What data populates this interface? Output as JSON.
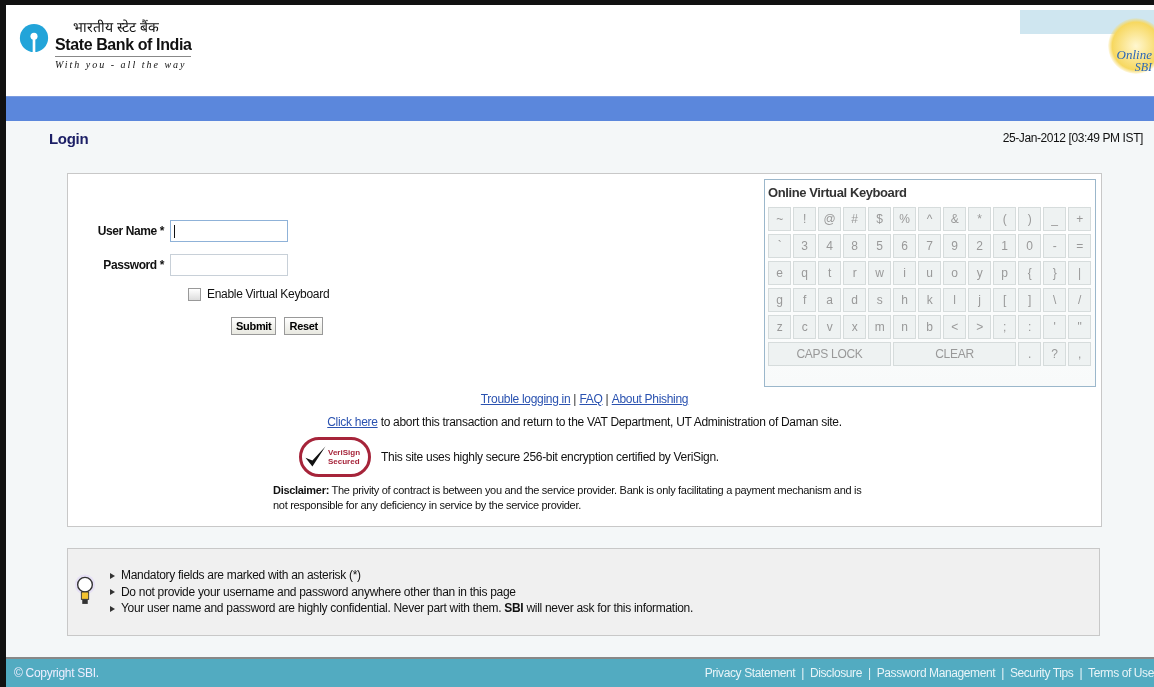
{
  "header": {
    "bank_name_hindi": "भारतीय स्टेट बैंक",
    "bank_name": "State Bank of India",
    "tagline": "With you - all the way",
    "online_logo": [
      "Online",
      "SBI"
    ]
  },
  "page_title": "Login",
  "datetime": "25-Jan-2012 [03:49 PM IST]",
  "form": {
    "fields": [
      {
        "label": "User Name *",
        "focused": true
      },
      {
        "label": "Password *",
        "focused": false
      }
    ],
    "virtual_keyboard_toggle": {
      "label": "Enable Virtual Keyboard",
      "checked": false
    },
    "buttons": [
      "Submit",
      "Reset"
    ]
  },
  "keyboard": {
    "title": "Online Virtual Keyboard",
    "rows": [
      [
        "~",
        "!",
        "@",
        "#",
        "$",
        "%",
        "^",
        "&",
        "*",
        "(",
        ")",
        "_",
        "+"
      ],
      [
        "`",
        "3",
        "4",
        "8",
        "5",
        "6",
        "7",
        "9",
        "2",
        "1",
        "0",
        "-",
        "="
      ],
      [
        "e",
        "q",
        "t",
        "r",
        "w",
        "i",
        "u",
        "o",
        "y",
        "p",
        "{",
        "}",
        "|"
      ],
      [
        "g",
        "f",
        "a",
        "d",
        "s",
        "h",
        "k",
        "l",
        "j",
        "[",
        "]",
        "\\",
        "/"
      ],
      [
        "z",
        "c",
        "v",
        "x",
        "m",
        "n",
        "b",
        "<",
        ">",
        ";",
        ":",
        "'",
        "\""
      ]
    ],
    "bottom_keys": [
      {
        "label": "CAPS LOCK",
        "kind": "wide"
      },
      {
        "label": "CLEAR",
        "kind": "wide"
      },
      {
        "label": ".",
        "kind": "key"
      },
      {
        "label": "?",
        "kind": "key"
      },
      {
        "label": ",",
        "kind": "key"
      }
    ]
  },
  "help_links": {
    "separator": "|",
    "links": [
      "Trouble logging in",
      "FAQ",
      "About Phishing"
    ]
  },
  "abort_notice": {
    "link": "Click here",
    "text": "to abort this transaction and return to the VAT Department, UT Administration of Daman site."
  },
  "verisign": {
    "badge": [
      "VeriSign",
      "Secured"
    ],
    "text": "This site uses highly secure 256-bit encryption certified by VeriSign."
  },
  "disclaimer": "**Disclaimer:** The privity of contract is between you and the service provider. Bank is only facilitating a payment mechanism and is not responsible for any deficiency in service by the service provider.",
  "tips": [
    "Mandatory fields are marked with an asterisk (*)",
    "Do not provide your username and password anywhere other than in this page",
    "Your user name and password are highly confidential. Never part with them. **SBI** will never ask for this information."
  ],
  "footer": {
    "copyright": "© Copyright SBI.",
    "separator": "|",
    "links": [
      "Privacy Statement",
      "Disclosure",
      "Password Management",
      "Security Tips",
      "Terms of Use"
    ]
  }
}
